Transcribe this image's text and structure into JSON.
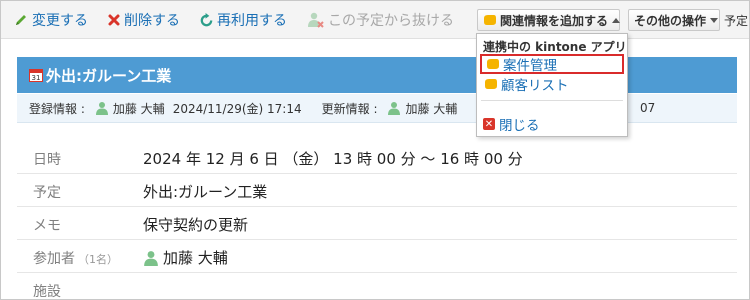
{
  "toolbar": {
    "edit_label": "変更する",
    "delete_label": "削除する",
    "reuse_label": "再利用する",
    "leave_label": "この予定から抜ける",
    "add_related_label": "関連情報を追加する",
    "other_actions_label": "その他の操作",
    "trailing_label": "予定の"
  },
  "event": {
    "title": "外出:ガルーン工業",
    "registered_label": "登録情報 :",
    "registered_user": "加藤 大輔",
    "registered_at": "2024/11/29(金) 17:14",
    "updated_label": "更新情報 :",
    "updated_user": "加藤 大輔",
    "updated_at_tail": "07"
  },
  "details": {
    "datetime_label": "日時",
    "datetime_value": "2024 年 12 月 6 日 （金） 13 時 00 分 ～ 16 時 00 分",
    "plan_label": "予定",
    "plan_value": "外出:ガルーン工業",
    "memo_label": "メモ",
    "memo_value": "保守契約の更新",
    "participants_label": "参加者",
    "participants_count": "（1名）",
    "participant_name": "加藤 大輔",
    "facility_label": "施設"
  },
  "dropdown": {
    "header": "連携中の kintone アプリ",
    "items": [
      "案件管理",
      "顧客リスト"
    ],
    "close_label": "閉じる"
  },
  "colors": {
    "link": "#1a6fb5",
    "title_bar": "#4e9bd3",
    "highlight_border": "#d92b2b",
    "user_icon": "#7cc28a",
    "kintone_icon": "#f5b400"
  },
  "icons": {
    "edit": "pencil-icon",
    "delete": "x-icon",
    "reuse": "refresh-icon",
    "leave": "user-remove-icon",
    "calendar": "calendar-icon",
    "user": "user-icon",
    "kintone": "kintone-icon",
    "close": "close-icon"
  }
}
